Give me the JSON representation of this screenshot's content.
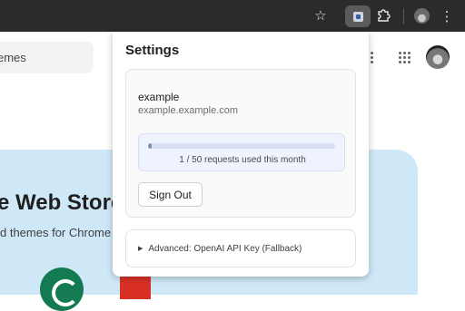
{
  "browser": {
    "icons": {
      "bookmark": "star-icon",
      "extension": "extension-icon",
      "extensions_menu": "puzzle-icon",
      "profile": "profile-icon",
      "menu": "kebab-icon"
    },
    "star_glyph": "☆",
    "menu_glyph": "⋮"
  },
  "page": {
    "search_text": "emes",
    "hero_title": "e Web Store",
    "hero_subtitle": "d themes for Chrome",
    "accent_hero_bg": "#cfe8f7"
  },
  "popup": {
    "title": "Settings",
    "account": {
      "name": "example",
      "email": "example.example.com"
    },
    "usage": {
      "used": 1,
      "limit": 50,
      "fraction": 0.02,
      "text": "1 / 50 requests used this month"
    },
    "sign_out_label": "Sign Out",
    "advanced_label": "Advanced: OpenAI API Key (Fallback)",
    "advanced_glyph": "▶"
  }
}
